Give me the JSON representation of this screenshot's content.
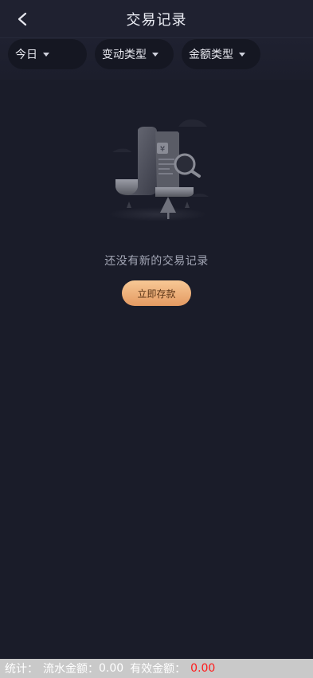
{
  "header": {
    "title": "交易记录",
    "back_icon": "chevron-left-icon"
  },
  "filters": [
    {
      "label": "今日",
      "icon": "caret-down-icon"
    },
    {
      "label": "变动类型",
      "icon": "caret-down-icon"
    },
    {
      "label": "金额类型",
      "icon": "caret-down-icon"
    }
  ],
  "empty_state": {
    "illustration": "empty-records-illustration",
    "message": "还没有新的交易记录",
    "button_label": "立即存款"
  },
  "footer": {
    "stats_label": "统计：",
    "turnover_label": "流水金额：",
    "turnover_value": "0.00",
    "valid_label": "有效金额：",
    "valid_value": "0.00",
    "value_color": "#ff1a1a"
  },
  "colors": {
    "background": "#1a1c29",
    "accent": "#e49a62"
  }
}
